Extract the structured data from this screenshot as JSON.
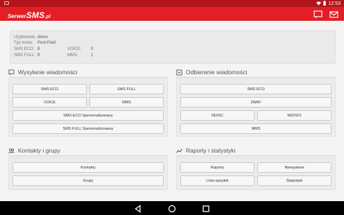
{
  "status_bar": {
    "time": "12:53"
  },
  "app": {
    "logo_prefix": "Serwer",
    "logo_main": "SMS",
    "logo_suffix": ".pl"
  },
  "account": {
    "rows": [
      {
        "key": "Użytkownik:",
        "value": "demo"
      },
      {
        "key": "Typ konta:",
        "value": "Post-Paid"
      },
      {
        "key": "SMS ECO:",
        "value": "8"
      },
      {
        "key": "SMS FULL:",
        "value": "9"
      }
    ],
    "extra": [
      {
        "key": "VOICE:",
        "value": "0"
      },
      {
        "key": "MMS:",
        "value": "1"
      }
    ]
  },
  "sections": {
    "send": {
      "title": "Wysyłanie wiadomości",
      "buttons": {
        "sms_eco": "SMS ECO",
        "sms_full": "SMS FULL",
        "voice": "VOICE",
        "mms": "MMS",
        "sms_eco_pers": "SMS ECO Spersonalizowany",
        "sms_full_pers": "SMS FULL Spersonalizowany"
      }
    },
    "receive": {
      "title": "Odbieranie wiadomości",
      "buttons": {
        "sms_eco": "SMS ECO",
        "twoway": "2WAY",
        "nd_sc": "ND/SC",
        "ndi_sci": "NDI/SCI",
        "mms": "MMS"
      }
    },
    "contacts": {
      "title": "Kontakty i grupy",
      "buttons": {
        "contacts": "Kontakty",
        "groups": "Grupy"
      }
    },
    "reports": {
      "title": "Raporty i statystyki",
      "buttons": {
        "reports": "Raporty",
        "unsent": "Niewysłane",
        "sent_list": "Lista wysyłek",
        "stats": "Statystyki"
      }
    }
  },
  "colors": {
    "statusbar": "#b3141b",
    "appbar": "#e31e25",
    "navbar": "#000000"
  }
}
